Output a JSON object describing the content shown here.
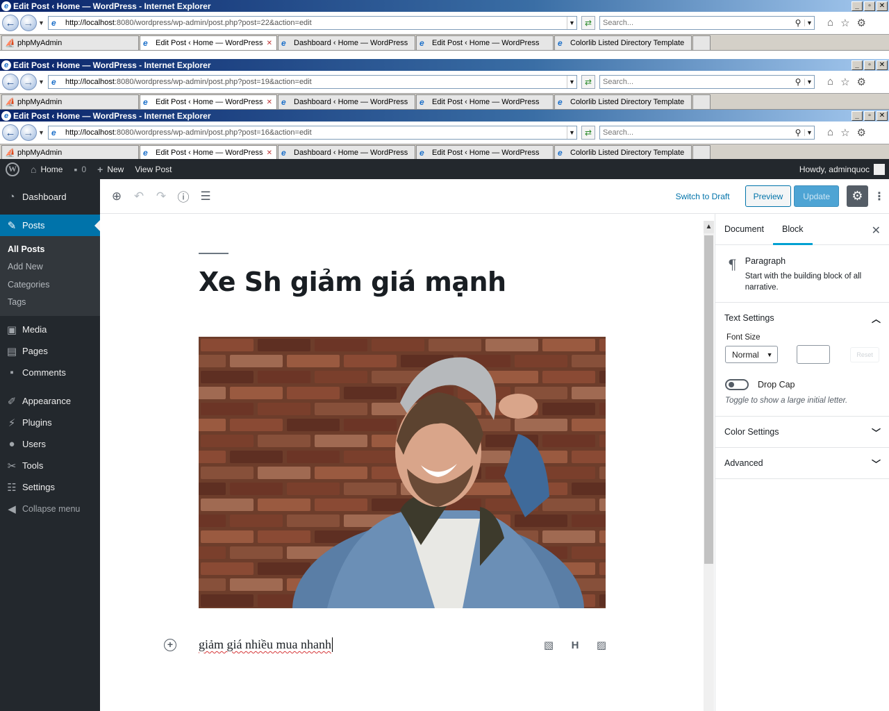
{
  "ie_windows": [
    {
      "title": "Edit Post ‹ Home — WordPress - Internet Explorer",
      "url_host": "http://localhost",
      "url_rest": ":8080/wordpress/wp-admin/post.php?post=22&action=edit",
      "search_placeholder": "Search..."
    },
    {
      "title": "Edit Post ‹ Home — WordPress - Internet Explorer",
      "url_host": "http://localhost",
      "url_rest": ":8080/wordpress/wp-admin/post.php?post=19&action=edit",
      "search_placeholder": "Search..."
    },
    {
      "title": "Edit Post ‹ Home — WordPress - Internet Explorer",
      "url_host": "http://localhost",
      "url_rest": ":8080/wordpress/wp-admin/post.php?post=16&action=edit",
      "search_placeholder": "Search..."
    }
  ],
  "ie_tabs": [
    {
      "label": "phpMyAdmin"
    },
    {
      "label": "Edit Post ‹ Home — WordPress"
    },
    {
      "label": "Dashboard ‹ Home — WordPress"
    },
    {
      "label": "Edit Post ‹ Home — WordPress"
    },
    {
      "label": "Colorlib Listed Directory Template"
    }
  ],
  "window_controls": {
    "minimize": "_",
    "maximize": "▫",
    "close": "✕"
  },
  "admin_bar": {
    "home": "Home",
    "comments_count": "0",
    "new": "New",
    "view_post": "View Post",
    "howdy": "Howdy, adminquoc"
  },
  "sidebar": {
    "dashboard": "Dashboard",
    "posts": "Posts",
    "posts_sub": [
      "All Posts",
      "Add New",
      "Categories",
      "Tags"
    ],
    "media": "Media",
    "pages": "Pages",
    "comments": "Comments",
    "appearance": "Appearance",
    "plugins": "Plugins",
    "users": "Users",
    "tools": "Tools",
    "settings": "Settings",
    "collapse": "Collapse menu"
  },
  "header": {
    "switch_to_draft": "Switch to Draft",
    "preview": "Preview",
    "update": "Update"
  },
  "post": {
    "title": "Xe Sh giảm giá mạnh",
    "paragraph": "giảm giá nhiều mua nhanh",
    "paragraph_tools": [
      "image-icon",
      "heading-icon",
      "gallery-icon"
    ]
  },
  "panel": {
    "tab_document": "Document",
    "tab_block": "Block",
    "block_name": "Paragraph",
    "block_desc": "Start with the building block of all narrative.",
    "text_settings": "Text Settings",
    "font_size_label": "Font Size",
    "font_size_value": "Normal",
    "reset": "Reset",
    "drop_cap": "Drop Cap",
    "drop_cap_help": "Toggle to show a large initial letter.",
    "color_settings": "Color Settings",
    "advanced": "Advanced"
  },
  "colors": {
    "admin_bar": "#23282d",
    "accent": "#0073aa",
    "update_button": "#4ea4d4"
  }
}
